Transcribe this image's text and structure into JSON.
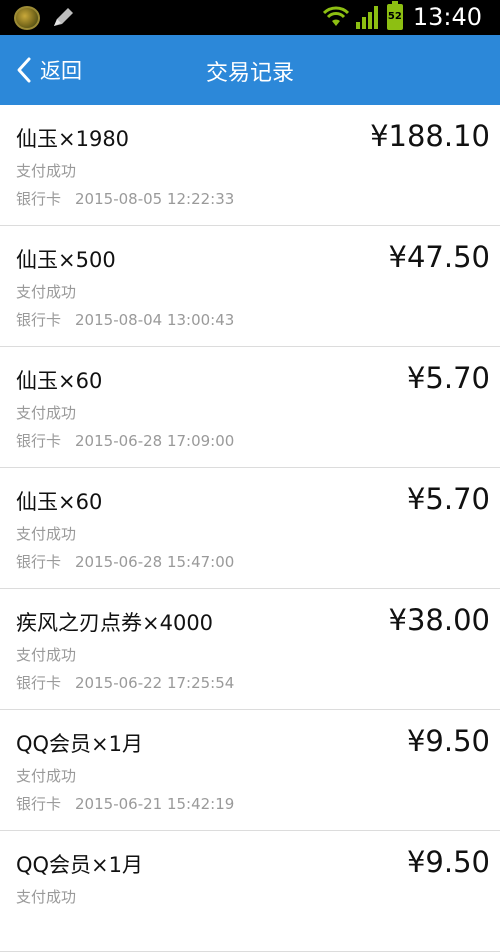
{
  "status_bar": {
    "battery_level": "52",
    "time": "13:40",
    "icons": [
      "app-badge-icon",
      "pen-icon",
      "wifi-icon",
      "signal-icon",
      "battery-icon"
    ]
  },
  "header": {
    "back_label": "返回",
    "title": "交易记录",
    "accent_color": "#2c88d9"
  },
  "transactions": [
    {
      "name": "仙玉×1980",
      "amount": "¥188.10",
      "status": "支付成功",
      "method": "银行卡",
      "datetime": "2015-08-05 12:22:33"
    },
    {
      "name": "仙玉×500",
      "amount": "¥47.50",
      "status": "支付成功",
      "method": "银行卡",
      "datetime": "2015-08-04 13:00:43"
    },
    {
      "name": "仙玉×60",
      "amount": "¥5.70",
      "status": "支付成功",
      "method": "银行卡",
      "datetime": "2015-06-28 17:09:00"
    },
    {
      "name": "仙玉×60",
      "amount": "¥5.70",
      "status": "支付成功",
      "method": "银行卡",
      "datetime": "2015-06-28 15:47:00"
    },
    {
      "name": "疾风之刃点券×4000",
      "amount": "¥38.00",
      "status": "支付成功",
      "method": "银行卡",
      "datetime": "2015-06-22 17:25:54"
    },
    {
      "name": "QQ会员×1月",
      "amount": "¥9.50",
      "status": "支付成功",
      "method": "银行卡",
      "datetime": "2015-06-21 15:42:19"
    },
    {
      "name": "QQ会员×1月",
      "amount": "¥9.50",
      "status": "支付成功",
      "method": "",
      "datetime": ""
    }
  ]
}
